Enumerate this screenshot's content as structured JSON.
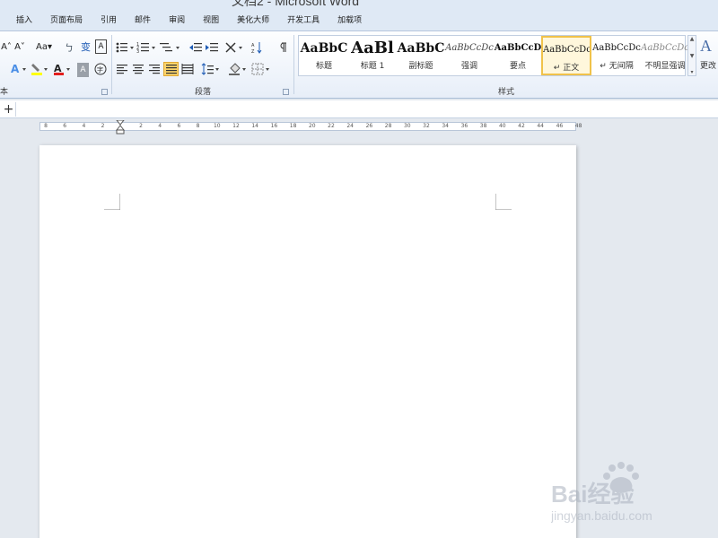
{
  "window": {
    "title": "文档2 - Microsoft Word"
  },
  "ribbon_tabs": [
    "插入",
    "页面布局",
    "引用",
    "邮件",
    "审阅",
    "视图",
    "美化大师",
    "开发工具",
    "加载项"
  ],
  "groups": {
    "font_label": "本",
    "paragraph_label": "段落",
    "styles_label": "样式"
  },
  "font_group": {
    "grow_label": "A˄",
    "shrink_label": "A˅",
    "case_label": "Aa▾",
    "phonetic_label": "ㄅ",
    "charborder_label": "A",
    "highlight_label": "aby▾",
    "fontcolor_label": "A▾",
    "charshade_label": "A",
    "enclose_label": "字"
  },
  "styles": [
    {
      "preview": "AaBbC",
      "name": "标题"
    },
    {
      "preview": "AaBl",
      "name": "标题 1"
    },
    {
      "preview": "AaBbC",
      "name": "副标题"
    },
    {
      "preview": "AaBbCcDc",
      "name": "强调"
    },
    {
      "preview": "AaBbCcD",
      "name": "要点"
    },
    {
      "preview": "AaBbCcDc",
      "name": "↵ 正文"
    },
    {
      "preview": "AaBbCcDc",
      "name": "↵ 无间隔"
    },
    {
      "preview": "AaBbCcDc",
      "name": "不明显强调"
    }
  ],
  "change_styles": {
    "label": "更改"
  },
  "quick_bar": {
    "plus_label": "+"
  },
  "ruler_ticks": [
    "8",
    "6",
    "4",
    "2",
    "",
    "2",
    "4",
    "6",
    "8",
    "10",
    "12",
    "14",
    "16",
    "18",
    "20",
    "22",
    "24",
    "26",
    "28",
    "30",
    "32",
    "34",
    "36",
    "38",
    "40",
    "42",
    "44",
    "46",
    "48"
  ],
  "watermark": {
    "brand": "Bai经验",
    "url": "jingyan.baidu.com"
  },
  "colors": {
    "accent": "#f0c24a",
    "tab_bg": "#dfe9f5",
    "canvas": "#e4e9ef"
  }
}
